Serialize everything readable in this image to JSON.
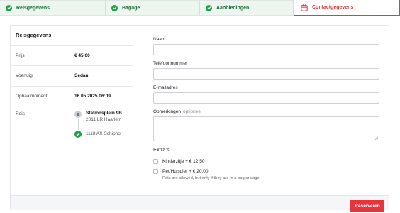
{
  "steps": [
    {
      "label": "Reisgegevens",
      "state": "completed",
      "icon": "check-circle-icon"
    },
    {
      "label": "Bagage",
      "state": "completed",
      "icon": "check-circle-icon"
    },
    {
      "label": "Aanbiedingen",
      "state": "completed",
      "icon": "check-circle-icon"
    },
    {
      "label": "Contactgegevens",
      "state": "active",
      "icon": "calendar-icon"
    }
  ],
  "summary": {
    "title": "Reisgegevens",
    "price_label": "Prijs",
    "price_value": "€ 45,00",
    "vehicle_label": "Voertuig",
    "vehicle_value": "Sedan",
    "pickup_label": "Ophaalmoment",
    "pickup_value": "16.05.2025 06:09",
    "trip_label": "Reis",
    "from_line1": "Stationsplein 9B",
    "from_line2": "2011 LR Haarlem",
    "to_line1": "1118 AX Schiphol"
  },
  "form": {
    "name_label": "Naam",
    "name_value": "",
    "phone_label": "Telefoonnummer",
    "phone_value": "",
    "email_label": "E-mailadres",
    "email_value": "",
    "remarks_label": "Opmerkingen",
    "remarks_optional": "optioneel",
    "remarks_value": ""
  },
  "extras": {
    "title": "Extra's",
    "items": [
      {
        "label": "Kinderzitje + € 12,50",
        "hint": "",
        "checked": false
      },
      {
        "label": "Pet/Huisdier + € 20,00",
        "hint": "Pets are allowed, but only if they are in a bag or cage.",
        "checked": false
      }
    ]
  },
  "footer": {
    "reserve_label": "Reserveren"
  },
  "colors": {
    "accent": "#e8333b",
    "success": "#22a04b",
    "step_done_bg": "#ecf6ee",
    "step_done_text": "#1f6b3a"
  }
}
